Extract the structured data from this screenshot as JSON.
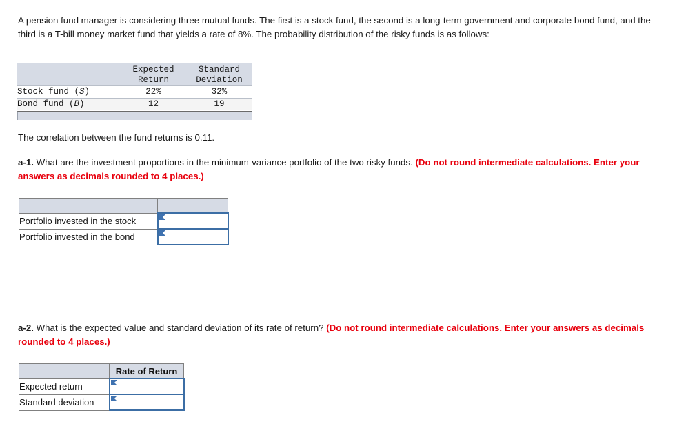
{
  "problem": {
    "intro": "A pension fund manager is considering three mutual funds. The first is a stock fund, the second is a long-term government and corporate bond fund, and the third is a T-bill money market fund that yields a rate of 8%. The probability distribution of the risky funds is as follows:",
    "correlation_text": "The correlation between the fund returns is 0.11."
  },
  "data_table": {
    "headers": {
      "blank": "",
      "col1_line1": "Expected",
      "col1_line2": "Return",
      "col2_line1": "Standard",
      "col2_line2": "Deviation"
    },
    "rows": [
      {
        "label_text": "Stock fund (",
        "label_symbol": "S",
        "label_close": ")",
        "expected_return": "22%",
        "standard_deviation": "32%"
      },
      {
        "label_text": "Bond fund (",
        "label_symbol": "B",
        "label_close": ")",
        "expected_return": "12",
        "standard_deviation": "19"
      }
    ]
  },
  "question_a1": {
    "label": "a-1.",
    "body": " What are the investment proportions in the minimum-variance portfolio of the two risky funds. ",
    "instruction": "(Do not round intermediate calculations. Enter your answers as decimals rounded to 4 places.)",
    "table": {
      "header_blank": "",
      "header_value": "",
      "rows": [
        {
          "label": "Portfolio invested in the stock",
          "value": "",
          "placeholder": ""
        },
        {
          "label": "Portfolio invested in the bond",
          "value": "",
          "placeholder": ""
        }
      ]
    }
  },
  "question_a2": {
    "label": "a-2.",
    "body": " What is the expected value and standard deviation of its rate of return? ",
    "instruction": "(Do not round intermediate calculations. Enter your answers as decimals rounded to 4 places.)",
    "table": {
      "header_blank": "",
      "header_value": "Rate of Return",
      "rows": [
        {
          "label": "Expected return",
          "value": "",
          "placeholder": ""
        },
        {
          "label": "Standard deviation",
          "value": "",
          "placeholder": ""
        }
      ]
    }
  },
  "colors": {
    "header_fill": "#d6dbe5",
    "input_border": "#3c6ea5",
    "instruction_red": "#e8000d"
  }
}
